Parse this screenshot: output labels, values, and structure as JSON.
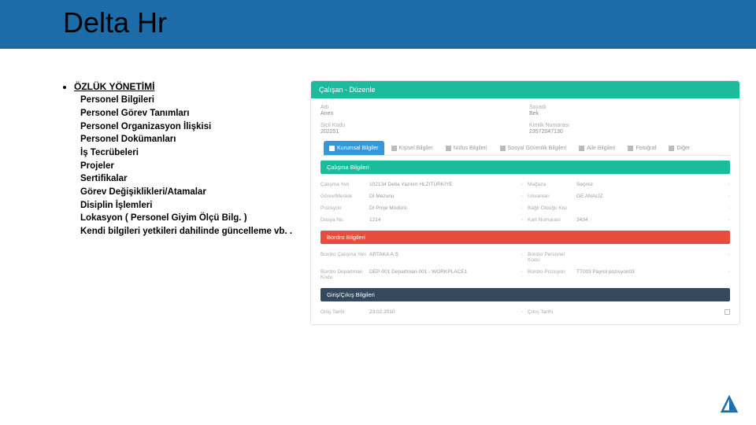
{
  "header": {
    "title": "Delta Hr"
  },
  "left": {
    "section_title": "ÖZLÜK YÖNETİMİ",
    "items": [
      "Personel Bilgileri",
      "Personel Görev Tanımları",
      "Personel Organizasyon İlişkisi",
      "Personel Dokümanları",
      "İş Tecrübeleri",
      "Projeler",
      "Sertifikalar",
      "Görev Değişiklikleri/Atamalar",
      "Disiplin İşlemleri",
      "Lokasyon ( Personel Giyim Ölçü Bilg. )",
      "Kendi bilgileri yetkileri dahilinde güncelleme vb. ."
    ]
  },
  "panel": {
    "title": "Çalışan - Düzenle",
    "basic": {
      "ad_lbl": "Adı",
      "ad_val": "Anen",
      "soyad_lbl": "Soyadı",
      "soyad_val": "Bek",
      "sicil_lbl": "Sicil Kodu",
      "sicil_val": "202251",
      "kimlik_lbl": "Kimlik Numarası",
      "kimlik_val": "23572047130"
    },
    "tabs": [
      "Kurumsal Bilgiler",
      "Kişisel Bilgiler",
      "Nüfus Bilgileri",
      "Sosyal Güvenlik Bilgileri",
      "Aile Bilgileri",
      "Fotoğraf",
      "Diğer"
    ],
    "sections": {
      "calisma": {
        "title": "Çalışma Bilgileri",
        "rows": [
          {
            "k1": "Çalışma Yeri",
            "v1": "102134 Delta Yazılım HLZ/TÜRKİYE",
            "k2": "Mağaza",
            "v2": "Seçiniz"
          },
          {
            "k1": "Görev/Meslek",
            "v1": "DI Mezunu",
            "k2": "Unvanları",
            "v2": "GE ANALİZ"
          },
          {
            "k1": "Pozisyon",
            "v1": "DI Proje Müdürü",
            "k2": "Bağlı Olduğu Kişi",
            "v2": ""
          },
          {
            "k1": "Dosya No",
            "v1": "1214",
            "k2": "Kart Numarası",
            "v2": "3434"
          }
        ]
      },
      "bordro": {
        "title": "Bordro Bilgileri",
        "rows": [
          {
            "k1": "Bordro Çalışma Yeri",
            "v1": "ARTAKA A.Ş",
            "k2": "Bordro Personel Kodu",
            "v2": ""
          },
          {
            "k1": "Bordro Departman Kodu",
            "v1": "DEP-001 Departman-001 - WORKPLACE1",
            "k2": "Bordro Pozisyon",
            "v2": "TT003 Payrol pozisyon03"
          }
        ]
      },
      "giris": {
        "title": "Giriş/Çıkış Bilgileri",
        "rows": [
          {
            "k1": "Giriş Tarihi",
            "v1": "23.02.2010",
            "k2": "Çıkış Tarihi",
            "v2": ""
          }
        ]
      }
    }
  }
}
